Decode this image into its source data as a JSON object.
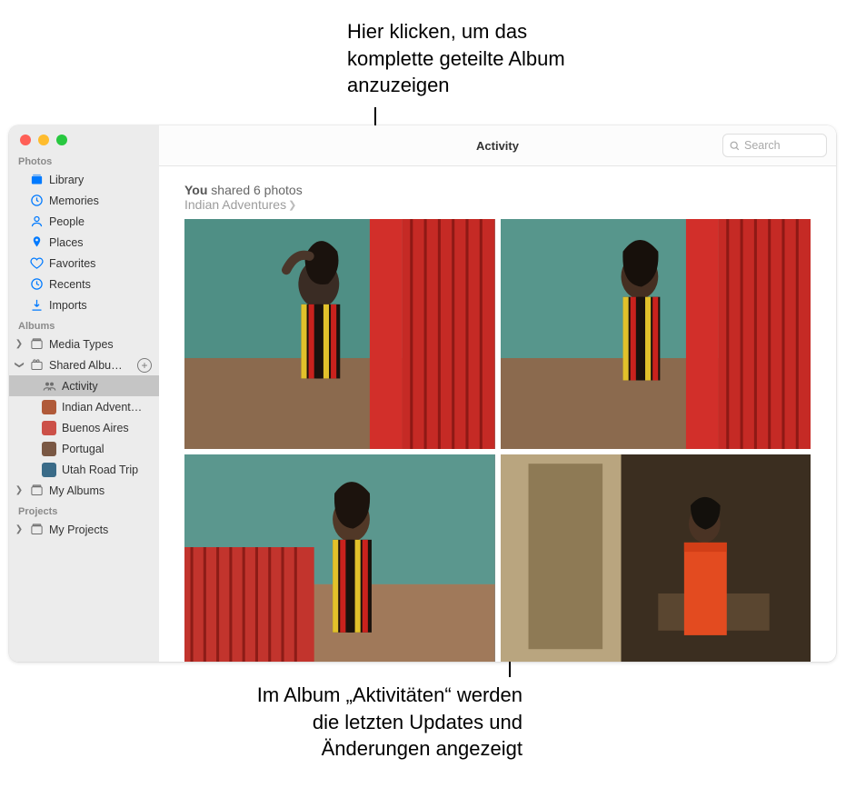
{
  "annotations": {
    "top": "Hier klicken, um das komplette geteilte Album anzuzeigen",
    "bottom": "Im Album „Aktivitäten“ werden die letzten Updates und Änderungen angezeigt"
  },
  "toolbar": {
    "title": "Activity",
    "search_placeholder": "Search"
  },
  "share": {
    "who": "You",
    "action": "shared 6 photos",
    "album": "Indian Adventures"
  },
  "sidebar": {
    "section_photos": "Photos",
    "section_albums": "Albums",
    "section_projects": "Projects",
    "photos_items": [
      {
        "label": "Library",
        "icon": "library"
      },
      {
        "label": "Memories",
        "icon": "memories"
      },
      {
        "label": "People",
        "icon": "people"
      },
      {
        "label": "Places",
        "icon": "places"
      },
      {
        "label": "Favorites",
        "icon": "favorites"
      },
      {
        "label": "Recents",
        "icon": "recents"
      },
      {
        "label": "Imports",
        "icon": "imports"
      }
    ],
    "albums_items": [
      {
        "label": "Media Types",
        "disclosure": "right"
      },
      {
        "label": "Shared Albu…",
        "disclosure": "down",
        "add": true
      }
    ],
    "shared_children": [
      {
        "label": "Activity",
        "selected": true,
        "icon": "activity"
      },
      {
        "label": "Indian Advent…",
        "thumb": "#b05a39"
      },
      {
        "label": "Buenos Aires",
        "thumb": "#cc5048"
      },
      {
        "label": "Portugal",
        "thumb": "#7a5844"
      },
      {
        "label": "Utah Road Trip",
        "thumb": "#3a6b88"
      }
    ],
    "my_albums": {
      "label": "My Albums",
      "disclosure": "right"
    },
    "my_projects": {
      "label": "My Projects",
      "disclosure": "right"
    }
  }
}
